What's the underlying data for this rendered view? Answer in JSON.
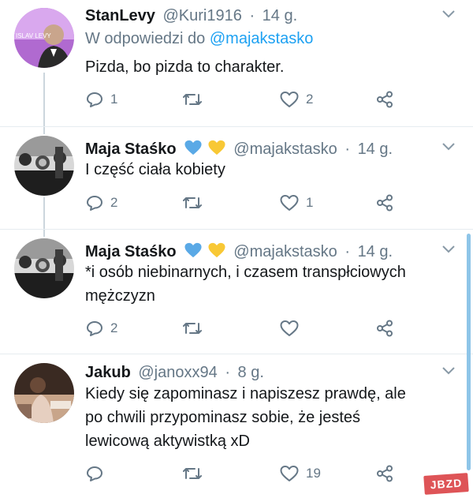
{
  "tweets": [
    {
      "name": "StanLevy",
      "handle": "@Kuri1916",
      "separator": "·",
      "time": "14 g.",
      "reply_prefix": "W odpowiedzi do",
      "reply_mention": "@majakstasko",
      "lines": [
        "Pizda, bo pizda to charakter."
      ],
      "replies": "1",
      "retweets": "",
      "likes": "2",
      "avatar_caption": "ISLAV LEVY"
    },
    {
      "name": "Maja Staśko",
      "handle": "@majakstasko",
      "separator": "·",
      "time": "14 g.",
      "lines": [
        "I część ciała kobiety"
      ],
      "replies": "2",
      "retweets": "",
      "likes": "1"
    },
    {
      "name": "Maja Staśko",
      "handle": "@majakstasko",
      "separator": "·",
      "time": "14 g.",
      "lines": [
        "*i osób niebinarnych, i czasem transpłciowych",
        "mężczyzn"
      ],
      "replies": "2",
      "retweets": "",
      "likes": ""
    },
    {
      "name": "Jakub",
      "handle": "@janoxx94",
      "separator": "·",
      "time": "8 g.",
      "lines": [
        "Kiedy się zapominasz i napiszesz prawdę, ale",
        "po chwili przypominasz sobie, że jesteś",
        "lewicową aktywistką xD"
      ],
      "replies": "",
      "retweets": "",
      "likes": "19"
    }
  ],
  "watermark": "JBZD",
  "colors": {
    "link": "#1da1f2",
    "secondary": "#657786",
    "heart_blue": "#5aa9e6",
    "heart_yellow": "#f8c835"
  },
  "icons": [
    "reply-icon",
    "retweet-icon",
    "like-icon",
    "share-icon",
    "chevron-down-icon",
    "blue-heart-icon",
    "yellow-heart-icon"
  ]
}
